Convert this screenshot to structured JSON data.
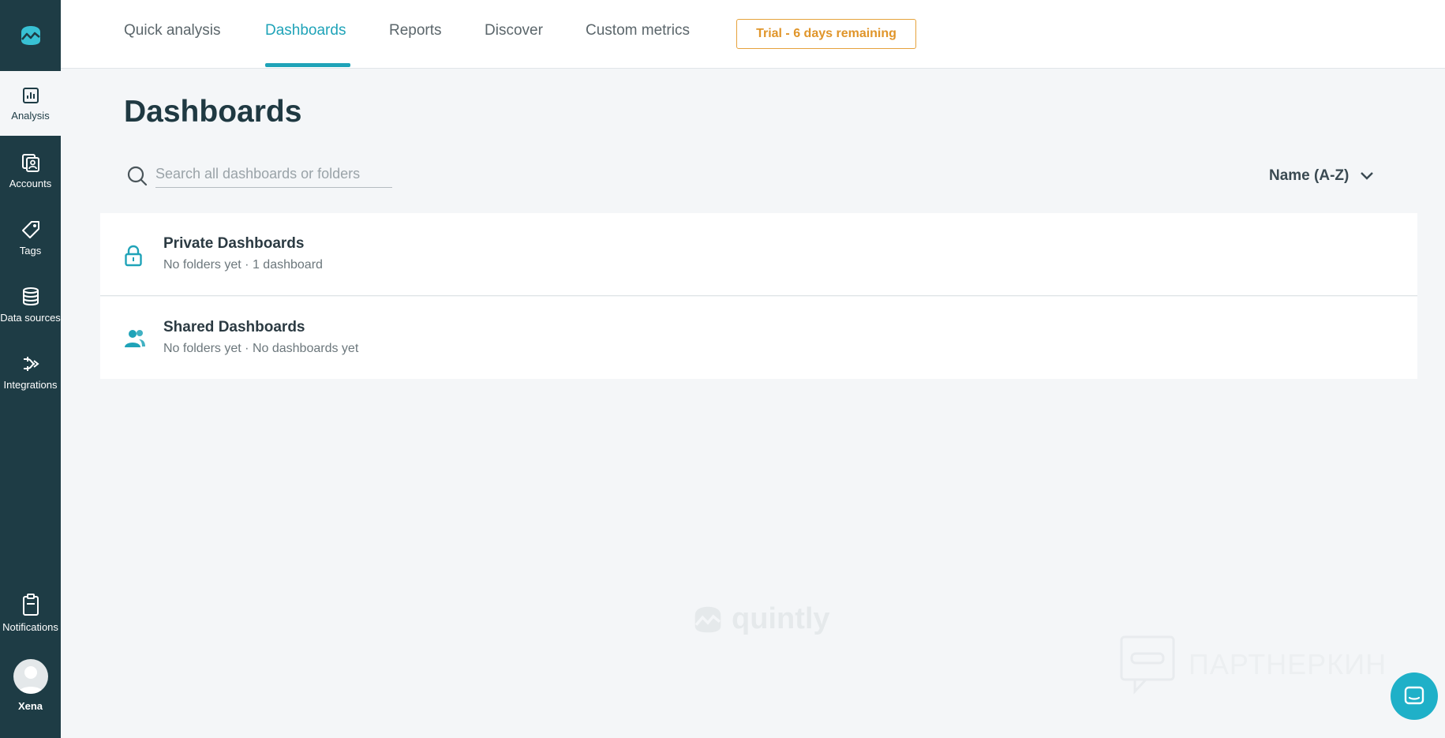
{
  "sidebar": {
    "items": [
      {
        "label": "Analysis",
        "icon": "bar-chart-icon"
      },
      {
        "label": "Accounts",
        "icon": "accounts-icon"
      },
      {
        "label": "Tags",
        "icon": "tag-icon"
      },
      {
        "label": "Data sources",
        "icon": "database-icon"
      },
      {
        "label": "Integrations",
        "icon": "integrations-icon"
      }
    ],
    "notifications": {
      "label": "Notifications",
      "icon": "clipboard-icon"
    },
    "user": {
      "name": "Xena"
    }
  },
  "topnav": {
    "tabs": [
      "Quick analysis",
      "Dashboards",
      "Reports",
      "Discover",
      "Custom metrics"
    ],
    "active_tab": "Dashboards",
    "trial_label": "Trial - 6 days remaining"
  },
  "main": {
    "title": "Dashboards",
    "search": {
      "placeholder": "Search all dashboards or folders",
      "value": ""
    },
    "sort": {
      "label": "Name (A-Z)"
    },
    "sections": [
      {
        "title": "Private Dashboards",
        "folders": "No folders yet",
        "dashboards": "1 dashboard",
        "icon": "lock-icon"
      },
      {
        "title": "Shared Dashboards",
        "folders": "No folders yet",
        "dashboards": "No dashboards yet",
        "icon": "users-icon"
      }
    ],
    "separator": "·"
  },
  "watermarks": {
    "brand": "quintly",
    "partner": "ПАРТНЕРКИН"
  },
  "colors": {
    "sidebar": "#1e3c45",
    "accent": "#1fa3b8",
    "trial": "#e0952a"
  }
}
